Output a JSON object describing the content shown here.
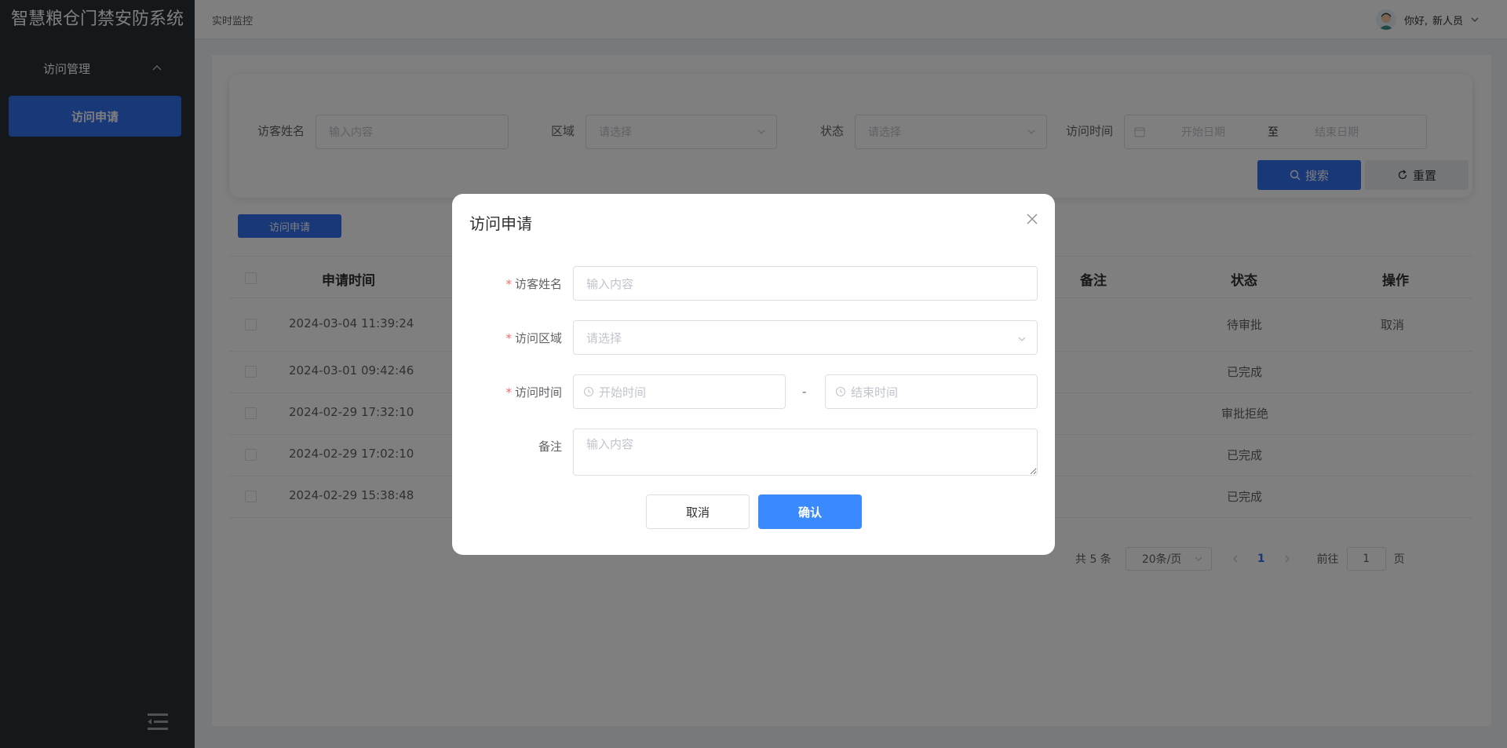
{
  "app": {
    "title": "智慧粮仓门禁安防系统"
  },
  "sidebar": {
    "group_label": "访问管理",
    "active_item": "访问申请"
  },
  "header": {
    "breadcrumb": "实时监控",
    "greeting": "你好,",
    "username": "新人员"
  },
  "search": {
    "visitor_label": "访客姓名",
    "visitor_placeholder": "输入内容",
    "area_label": "区域",
    "area_placeholder": "请选择",
    "status_label": "状态",
    "status_placeholder": "请选择",
    "time_label": "访问时间",
    "start_placeholder": "开始日期",
    "range_sep": "至",
    "end_placeholder": "结束日期",
    "search_button": "搜索",
    "reset_button": "重置"
  },
  "toolbar": {
    "apply_button": "访问申请"
  },
  "table": {
    "columns": {
      "time": "申请时间",
      "note": "备注",
      "status": "状态",
      "action": "操作"
    },
    "rows": [
      {
        "time": "2024-03-04 11:39:24",
        "status": "待审批",
        "action": "取消"
      },
      {
        "time": "2024-03-01 09:42:46",
        "status": "已完成",
        "action": ""
      },
      {
        "time": "2024-02-29 17:32:10",
        "status": "审批拒绝",
        "action": ""
      },
      {
        "time": "2024-02-29 17:02:10",
        "status": "已完成",
        "action": ""
      },
      {
        "time": "2024-02-29 15:38:48",
        "status": "已完成",
        "action": ""
      }
    ]
  },
  "pagination": {
    "total": "共 5 条",
    "page_size": "20条/页",
    "current_page": "1",
    "goto_label": "前往",
    "goto_value": "1",
    "page_unit": "页"
  },
  "dialog": {
    "title": "访问申请",
    "visitor_label": "访客姓名",
    "visitor_placeholder": "输入内容",
    "area_label": "访问区域",
    "area_placeholder": "请选择",
    "time_label": "访问时间",
    "start_placeholder": "开始时间",
    "range_sep": "-",
    "end_placeholder": "结束时间",
    "note_label": "备注",
    "note_placeholder": "输入内容",
    "required_mark": "*",
    "cancel_button": "取消",
    "confirm_button": "确认"
  },
  "colors": {
    "sidebar_bg": "#2b3035",
    "primary": "#3370f0",
    "dialog_primary": "#3a8afd",
    "required": "#f56c6c",
    "overlay": "rgba(0,0,0,0.5)"
  }
}
